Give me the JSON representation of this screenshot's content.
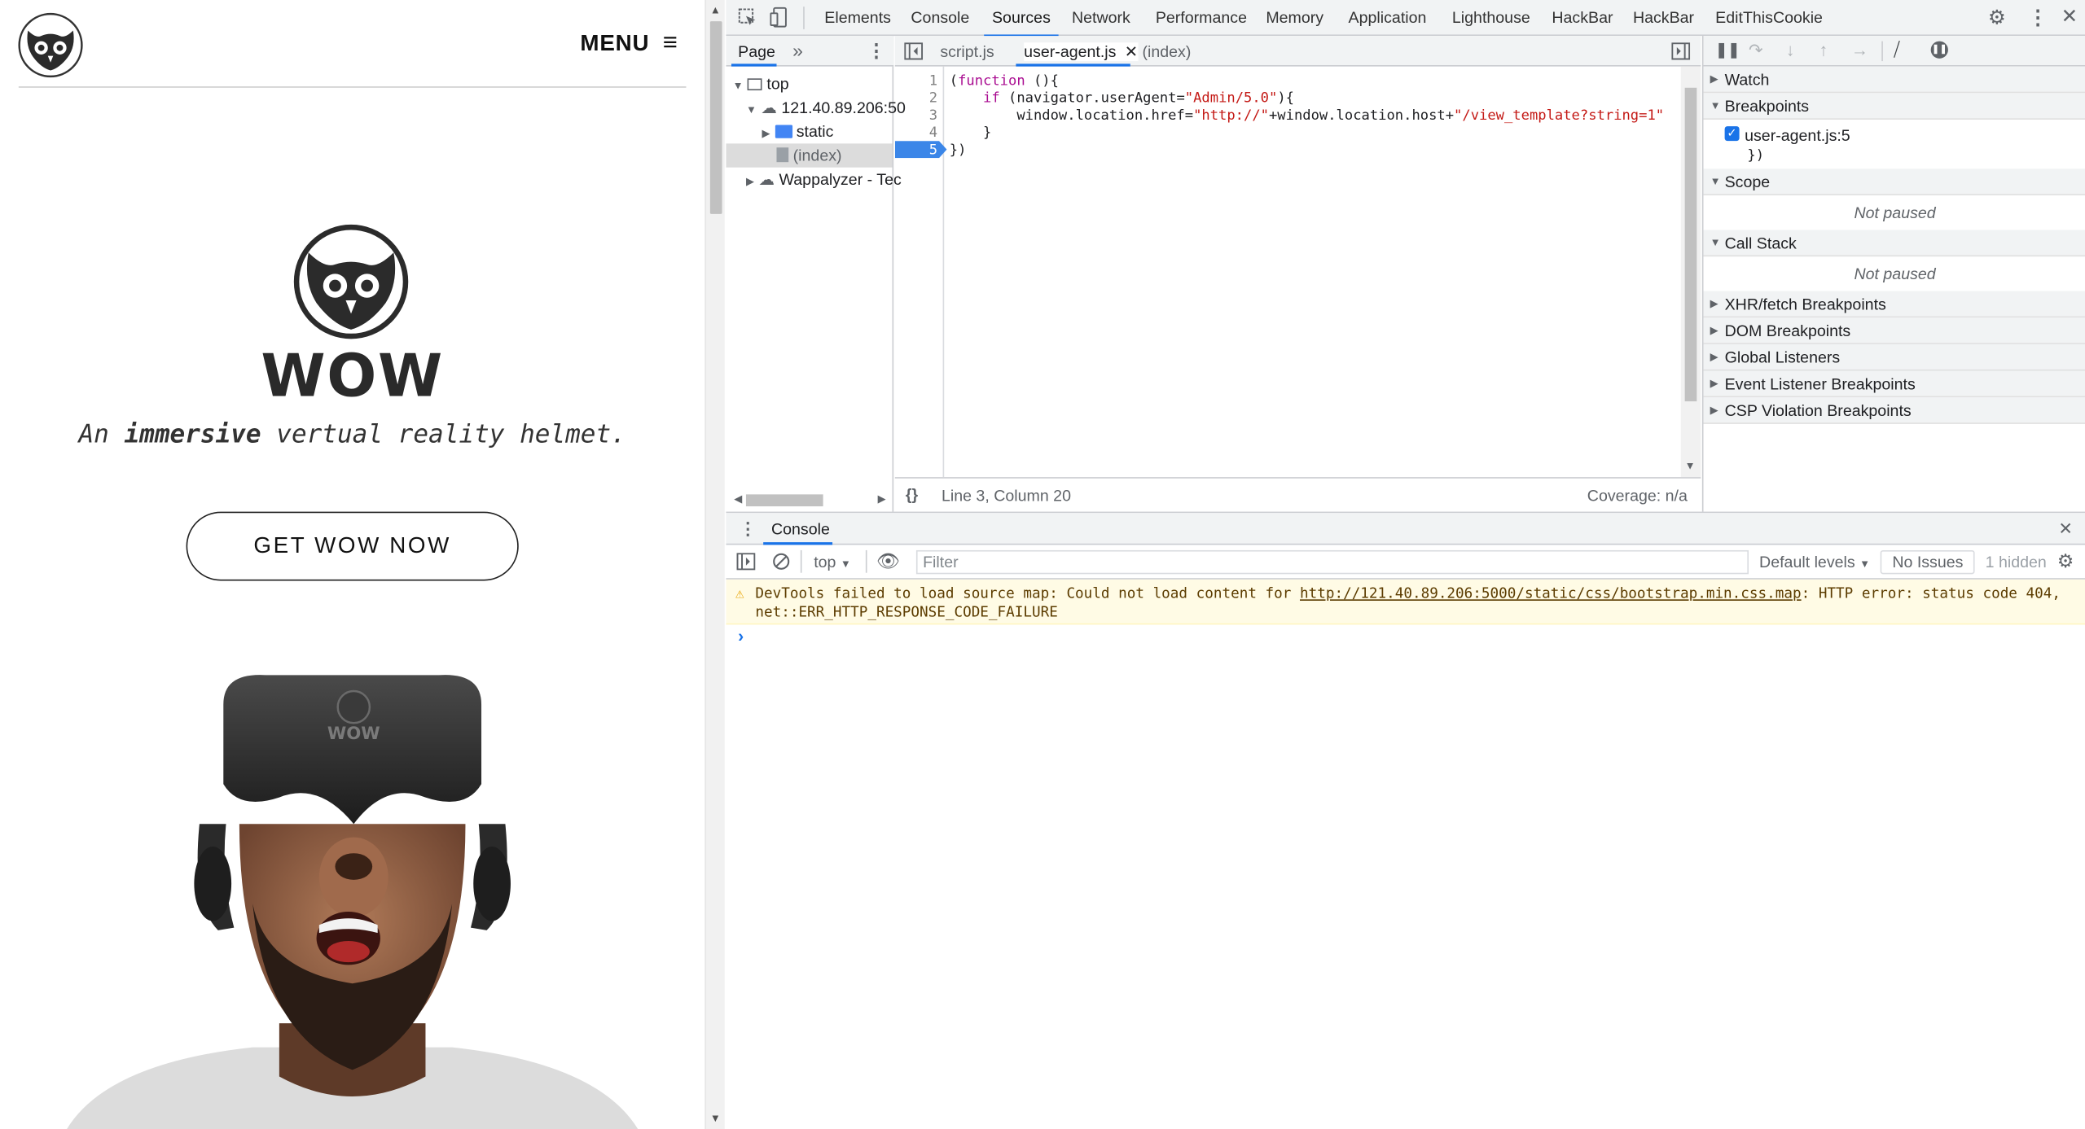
{
  "site": {
    "menu_label": "MENU",
    "menu_icon": "≡",
    "brand": "WOW",
    "tagline_pre": "An ",
    "tagline_bold": "immersive",
    "tagline_post": " vertual reality helmet.",
    "cta": "GET WOW NOW",
    "hero_helmet_text": "WOW"
  },
  "devtools": {
    "tabs": [
      "Elements",
      "Console",
      "Sources",
      "Network",
      "Performance",
      "Memory",
      "Application",
      "Lighthouse",
      "HackBar",
      "HackBar",
      "EditThisCookie"
    ],
    "active_tab": "Sources",
    "navigator": {
      "tab": "Page",
      "more": "»",
      "tree": {
        "top": "top",
        "host": "121.40.89.206:50",
        "static": "static",
        "index": "(index)",
        "wappalyzer": "Wappalyzer - Tec"
      }
    },
    "editor": {
      "tabs": [
        "script.js",
        "user-agent.js",
        "(index)"
      ],
      "active_file": "user-agent.js",
      "line_numbers": [
        "1",
        "2",
        "3",
        "4",
        "5"
      ],
      "lines": {
        "l1_kw": "function",
        "l1_pre": "(",
        "l1_post": " (){",
        "l2_kw": "if",
        "l2_pre": "    ",
        "l2_mid": " (navigator.userAgent=",
        "l2_str": "\"Admin/5.0\"",
        "l2_post": "){",
        "l3_pre": "        window.location.href=",
        "l3_str1": "\"http://\"",
        "l3_mid": "+window.location.host+",
        "l3_str2": "\"/view_template?string=1\"",
        "l4": "    }",
        "l5": "})"
      },
      "status": "Line 3, Column 20",
      "coverage": "Coverage: n/a",
      "format_icon": "{}"
    },
    "debugger": {
      "watch": "Watch",
      "breakpoints": "Breakpoints",
      "breakpoint_file": "user-agent.js:5",
      "breakpoint_code": "})",
      "scope": "Scope",
      "not_paused_1": "Not paused",
      "call_stack": "Call Stack",
      "not_paused_2": "Not paused",
      "xhr": "XHR/fetch Breakpoints",
      "dom": "DOM Breakpoints",
      "global": "Global Listeners",
      "event": "Event Listener Breakpoints",
      "csp": "CSP Violation Breakpoints"
    },
    "console": {
      "title": "Console",
      "context": "top",
      "filter_placeholder": "Filter",
      "levels": "Default levels",
      "issues": "No Issues",
      "hidden": "1 hidden",
      "warn_pre": "DevTools failed to load source map: Could not load content for ",
      "warn_link": "http://121.40.89.206:5000/static/css/bootstrap.min.css.map",
      "warn_post": ": HTTP error: status code 404,",
      "warn_line2": "net::ERR_HTTP_RESPONSE_CODE_FAILURE",
      "prompt": "›"
    }
  }
}
